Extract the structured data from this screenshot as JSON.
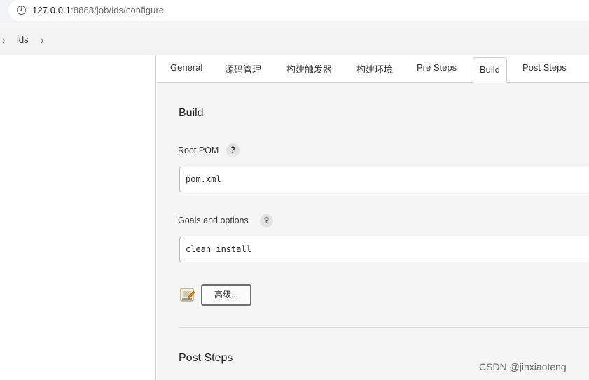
{
  "address_bar": {
    "host": "127.0.0.1",
    "path": ":8888/job/ids/configure"
  },
  "breadcrumb": {
    "items": [
      "ids"
    ]
  },
  "tabs": [
    {
      "label": "General"
    },
    {
      "label": "源码管理"
    },
    {
      "label": "构建触发器"
    },
    {
      "label": "构建环境"
    },
    {
      "label": "Pre Steps"
    },
    {
      "label": "Build",
      "active": true
    },
    {
      "label": "Post Steps"
    }
  ],
  "build": {
    "title": "Build",
    "root_pom_label": "Root POM",
    "root_pom_value": "pom.xml",
    "goals_label": "Goals and options",
    "goals_value": "clean install",
    "help_glyph": "?",
    "advanced_button": "高级...",
    "advanced_icon": "notepad-icon"
  },
  "post_steps": {
    "title": "Post Steps"
  },
  "watermark": "CSDN @jinxiaoteng",
  "colors": {
    "content_bg": "#f5f5f5",
    "tab_border": "#cfcfcf",
    "button_border": "#6f6f6f"
  }
}
